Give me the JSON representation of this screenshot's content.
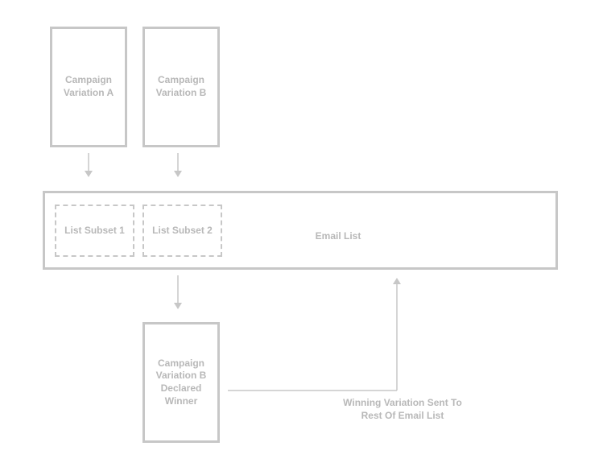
{
  "variationA": "Campaign Variation A",
  "variationB": "Campaign Variation B",
  "subset1": "List Subset 1",
  "subset2": "List Subset 2",
  "emailList": "Email List",
  "winner": "Campaign Variation B Declared Winner",
  "winningNote": "Winning Variation Sent To Rest Of Email List"
}
